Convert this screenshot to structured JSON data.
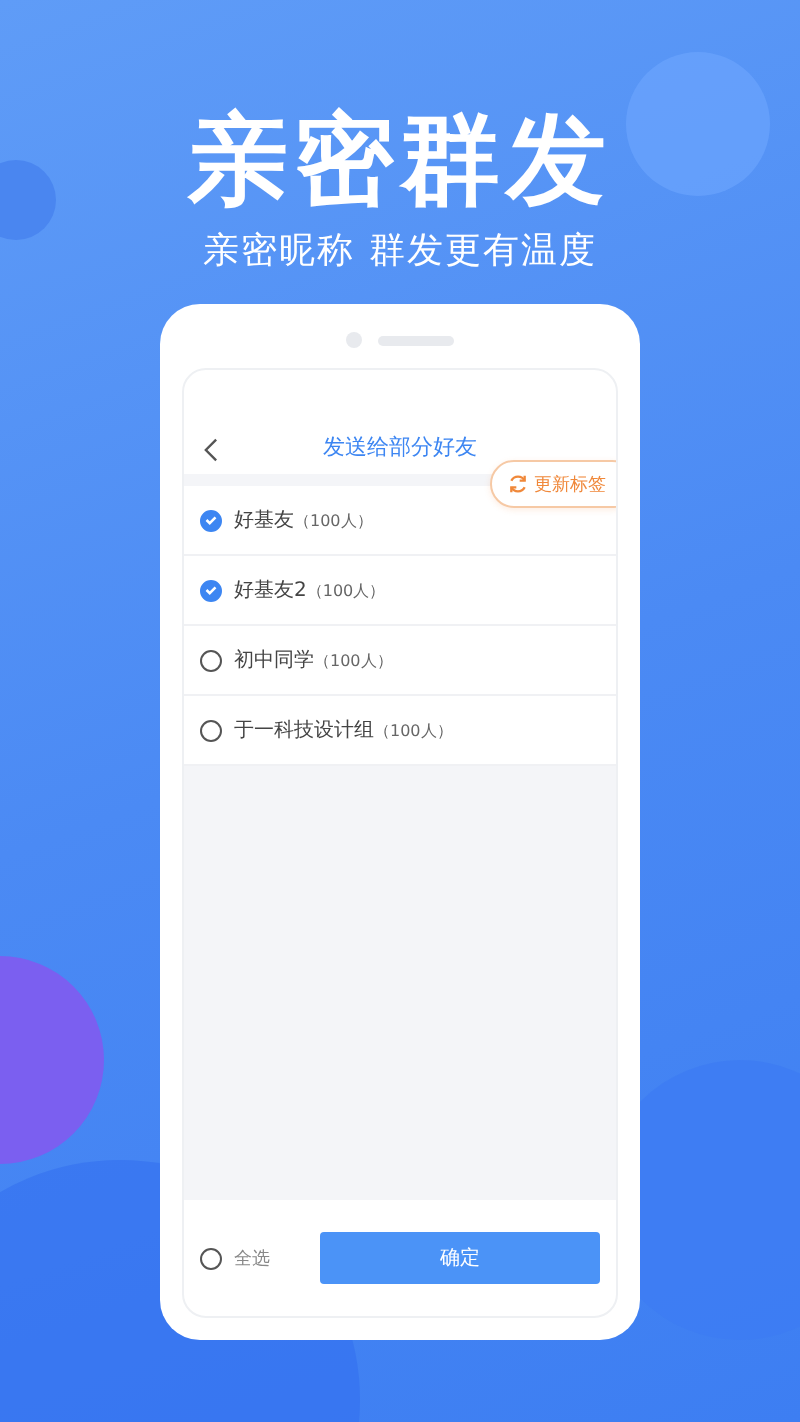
{
  "headline": "亲密群发",
  "tagline": "亲密昵称 群发更有温度",
  "screen": {
    "title": "发送给部分好友",
    "tag_button": "更新标签",
    "groups": [
      {
        "name": "好基友",
        "count": "（100人）",
        "checked": true
      },
      {
        "name": "好基友2",
        "count": "（100人）",
        "checked": true
      },
      {
        "name": "初中同学",
        "count": "（100人）",
        "checked": false
      },
      {
        "name": "于一科技设计组",
        "count": "（100人）",
        "checked": false
      }
    ],
    "select_all": {
      "label": "全选",
      "checked": false
    },
    "confirm_button": "确定"
  }
}
